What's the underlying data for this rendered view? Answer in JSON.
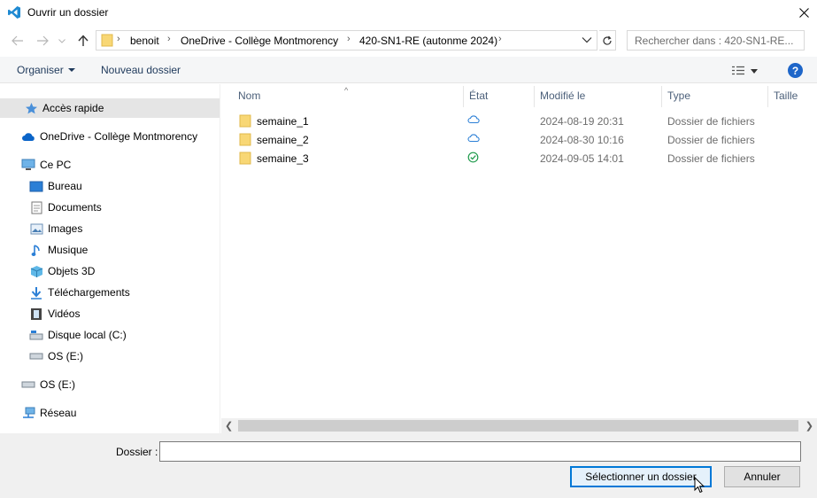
{
  "window": {
    "title": "Ouvrir un dossier"
  },
  "address": {
    "crumbs": [
      "benoit",
      "OneDrive - Collège Montmorency",
      "420-SN1-RE (autonme 2024)"
    ]
  },
  "search": {
    "placeholder": "Rechercher dans : 420-SN1-RE..."
  },
  "toolbar": {
    "organize_label": "Organiser",
    "new_folder_label": "Nouveau dossier",
    "help_label": "?"
  },
  "sidebar": {
    "items": [
      {
        "label": "Accès rapide",
        "icon": "star-icon"
      },
      {
        "label": "OneDrive - Collège Montmorency",
        "icon": "cloud-icon"
      },
      {
        "label": "Ce PC",
        "icon": "computer-icon"
      },
      {
        "label": "Bureau",
        "icon": "desktop-icon"
      },
      {
        "label": "Documents",
        "icon": "document-icon"
      },
      {
        "label": "Images",
        "icon": "pictures-icon"
      },
      {
        "label": "Musique",
        "icon": "music-icon"
      },
      {
        "label": "Objets 3D",
        "icon": "cube-icon"
      },
      {
        "label": "Téléchargements",
        "icon": "download-icon"
      },
      {
        "label": "Vidéos",
        "icon": "video-icon"
      },
      {
        "label": "Disque local (C:)",
        "icon": "drive-icon"
      },
      {
        "label": "OS (E:)",
        "icon": "drive-icon"
      },
      {
        "label": "OS (E:)",
        "icon": "drive-icon"
      },
      {
        "label": "Réseau",
        "icon": "network-icon"
      }
    ]
  },
  "columns": {
    "name": "Nom",
    "state": "État",
    "modified": "Modifié le",
    "type": "Type",
    "size": "Taille"
  },
  "files": [
    {
      "name": "semaine_1",
      "state": "cloud-icon",
      "modified": "2024-08-19 20:31",
      "type": "Dossier de fichiers"
    },
    {
      "name": "semaine_2",
      "state": "cloud-icon",
      "modified": "2024-08-30 10:16",
      "type": "Dossier de fichiers"
    },
    {
      "name": "semaine_3",
      "state": "check-icon",
      "modified": "2024-09-05 14:01",
      "type": "Dossier de fichiers"
    }
  ],
  "footer": {
    "folder_label": "Dossier :",
    "folder_value": "",
    "select_label": "Sélectionner un dossier",
    "cancel_label": "Annuler"
  },
  "colors": {
    "accent": "#0078d7",
    "folder": "#f8d775",
    "link": "#1e395b"
  }
}
